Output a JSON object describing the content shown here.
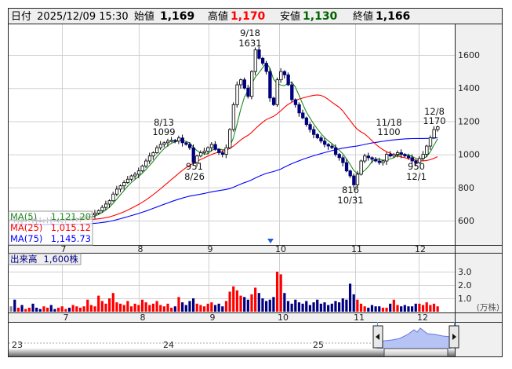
{
  "header": {
    "date_label": "日付",
    "date_value": "2025/12/09 15:30",
    "open_label": "始値",
    "open_value": "1,169",
    "high_label": "高値",
    "high_value": "1,170",
    "low_label": "安値",
    "low_value": "1,130",
    "close_label": "終値",
    "close_value": "1,166"
  },
  "legend": {
    "ma5_label": "MA(5)",
    "ma5_value": "1,121.20",
    "ma25_label": "MA(25)",
    "ma25_value": "1,015.12",
    "ma75_label": "MA(75)",
    "ma75_value": "1,145.73"
  },
  "volume_legend": {
    "label": "出来高",
    "value": "1,600株"
  },
  "volume_unit": "(万株)",
  "colors": {
    "up_volume": "#ff0000",
    "down": "#000080",
    "ma5": "#228b22",
    "ma25": "#ff0000",
    "ma75": "#0000ff",
    "high": "#ff0000",
    "low": "#006400"
  },
  "chart_data": {
    "type": "candlestick",
    "price_ticks": [
      "1600",
      "1400",
      "1200",
      "1000",
      "800",
      "600"
    ],
    "price_tick_values": [
      1600,
      1400,
      1200,
      1000,
      800,
      600
    ],
    "ylim": [
      450,
      1780
    ],
    "month_labels": [
      "7",
      "8",
      "9",
      "10",
      "11",
      "12"
    ],
    "volume_ticks": [
      "3.0",
      "2.0",
      "1.0"
    ],
    "volume_tick_values": [
      3,
      2,
      1
    ],
    "closes": [
      605,
      600,
      602,
      598,
      604,
      606,
      603,
      600,
      598,
      602,
      605,
      604,
      600,
      603,
      606,
      608,
      605,
      610,
      612,
      615,
      618,
      625,
      635,
      645,
      660,
      680,
      700,
      720,
      760,
      790,
      810,
      830,
      850,
      870,
      880,
      900,
      930,
      960,
      990,
      1010,
      1040,
      1060,
      1070,
      1080,
      1085,
      1080,
      1099,
      1070,
      1060,
      1040,
      951,
      990,
      1010,
      1020,
      1040,
      1060,
      1030,
      1010,
      1000,
      1040,
      1150,
      1300,
      1420,
      1450,
      1400,
      1350,
      1500,
      1631,
      1580,
      1550,
      1500,
      1340,
      1300,
      1450,
      1500,
      1480,
      1420,
      1330,
      1300,
      1250,
      1220,
      1180,
      1150,
      1120,
      1100,
      1080,
      1060,
      1050,
      1040,
      1000,
      980,
      950,
      900,
      870,
      816,
      880,
      960,
      990,
      980,
      970,
      960,
      950,
      960,
      1000,
      990,
      1000,
      1010,
      1000,
      990,
      980,
      960,
      950,
      975,
      1000,
      1050,
      1100,
      1150,
      1166
    ],
    "volumes": [
      0.4,
      0.9,
      0.3,
      0.5,
      0.2,
      0.3,
      0.6,
      0.3,
      0.2,
      0.4,
      0.3,
      0.5,
      0.2,
      0.3,
      0.4,
      0.2,
      0.3,
      0.5,
      0.4,
      0.3,
      0.4,
      0.9,
      0.5,
      0.4,
      1.2,
      0.8,
      0.6,
      1.0,
      1.4,
      0.7,
      0.6,
      0.5,
      0.8,
      0.4,
      0.6,
      0.5,
      0.9,
      0.7,
      0.5,
      0.6,
      0.8,
      0.5,
      0.4,
      0.6,
      0.3,
      0.4,
      1.1,
      0.7,
      0.5,
      0.8,
      1.0,
      0.6,
      0.5,
      0.4,
      0.6,
      0.7,
      0.5,
      0.6,
      0.4,
      0.8,
      1.5,
      1.9,
      1.6,
      1.2,
      1.1,
      0.9,
      1.3,
      1.8,
      1.4,
      1.0,
      0.8,
      0.9,
      1.1,
      3.0,
      2.8,
      1.4,
      0.8,
      0.6,
      0.9,
      0.7,
      0.6,
      0.8,
      0.5,
      0.7,
      0.9,
      0.6,
      0.7,
      0.5,
      0.6,
      0.8,
      0.7,
      1.0,
      0.9,
      2.1,
      1.3,
      0.9,
      0.6,
      0.4,
      0.3,
      0.5,
      0.4,
      0.4,
      0.3,
      0.3,
      0.6,
      0.9,
      0.5,
      0.4,
      0.5,
      0.4,
      0.4,
      0.6,
      0.6,
      0.5,
      0.7,
      0.5,
      0.6,
      0.4
    ],
    "annotations": [
      {
        "date": "9/18",
        "price": "1631"
      },
      {
        "date": "8/13",
        "price": "1099"
      },
      {
        "date": "8/26",
        "price": "951"
      },
      {
        "date": "10/31",
        "price": "816"
      },
      {
        "date": "11/18",
        "price": "1100"
      },
      {
        "date": "12/1",
        "price": "950"
      },
      {
        "date": "12/8",
        "price": "1170"
      }
    ],
    "navigator_labels": [
      "23",
      "24",
      "25"
    ]
  }
}
